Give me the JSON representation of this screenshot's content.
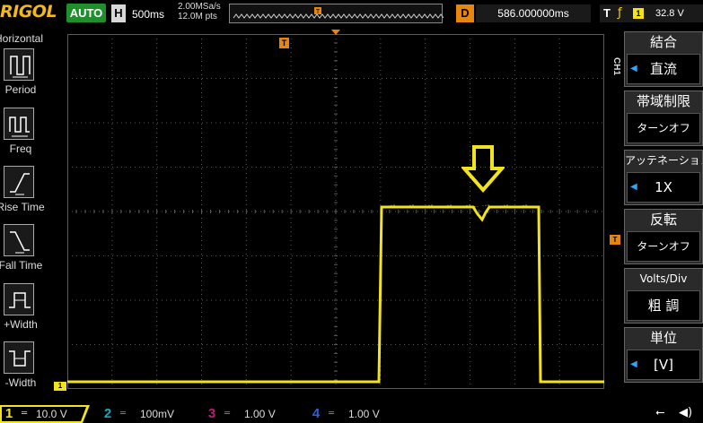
{
  "topbar": {
    "brand": "RIGOL",
    "run_mode": "AUTO",
    "horizontal_letter": "H",
    "timebase": "500ms",
    "sample_rate": "2.00MSa/s",
    "memory_depth": "12.0M pts",
    "memory_trigger_marker": "T",
    "delay_letter": "D",
    "delay": "586.000000ms",
    "trigger_letter": "T",
    "trigger_source": "1",
    "trigger_level": "32.8 V"
  },
  "left_sidebar": {
    "title": "Horizontal",
    "items": [
      {
        "label": "Period",
        "icon": "period-icon"
      },
      {
        "label": "Freq",
        "icon": "freq-icon"
      },
      {
        "label": "Rise Time",
        "icon": "rise-time-icon"
      },
      {
        "label": "Fall Time",
        "icon": "fall-time-icon"
      },
      {
        "label": "+Width",
        "icon": "positive-width-icon"
      },
      {
        "label": "-Width",
        "icon": "negative-width-icon"
      }
    ]
  },
  "right_sidebar": {
    "channel_label": "CH1",
    "menus": [
      {
        "title": "結合",
        "value": "直流",
        "has_arrow": true
      },
      {
        "title": "帯域制限",
        "value": "ターンオフ",
        "has_arrow": false
      },
      {
        "title": "アッテネーション",
        "value": "1X",
        "has_arrow": true
      },
      {
        "title": "反転",
        "value": "ターンオフ",
        "has_arrow": false
      },
      {
        "title": "Volts/Div",
        "value": "粗 調",
        "has_arrow": false
      },
      {
        "title": "単位",
        "value": "[V]",
        "has_arrow": true
      }
    ]
  },
  "markers": {
    "trigger_position": "T",
    "trigger_level": "T",
    "ch1_ground": "1"
  },
  "waveform": {
    "color": "#f2e31c",
    "grid_color": "#5a5a5a"
  },
  "annotation": {
    "arrow_color": "#f2e31c"
  },
  "bottombar": {
    "channels": [
      {
        "num": "1",
        "scale": "10.0 V",
        "color": "#f2e31c"
      },
      {
        "num": "2",
        "scale": "100mV",
        "color": "#1ba8b8"
      },
      {
        "num": "3",
        "scale": "1.00 V",
        "color": "#c0187a"
      },
      {
        "num": "4",
        "scale": "1.00 V",
        "color": "#2a62d8"
      }
    ],
    "usb_icon": "usb-icon",
    "speaker_icon": "speaker-icon"
  }
}
